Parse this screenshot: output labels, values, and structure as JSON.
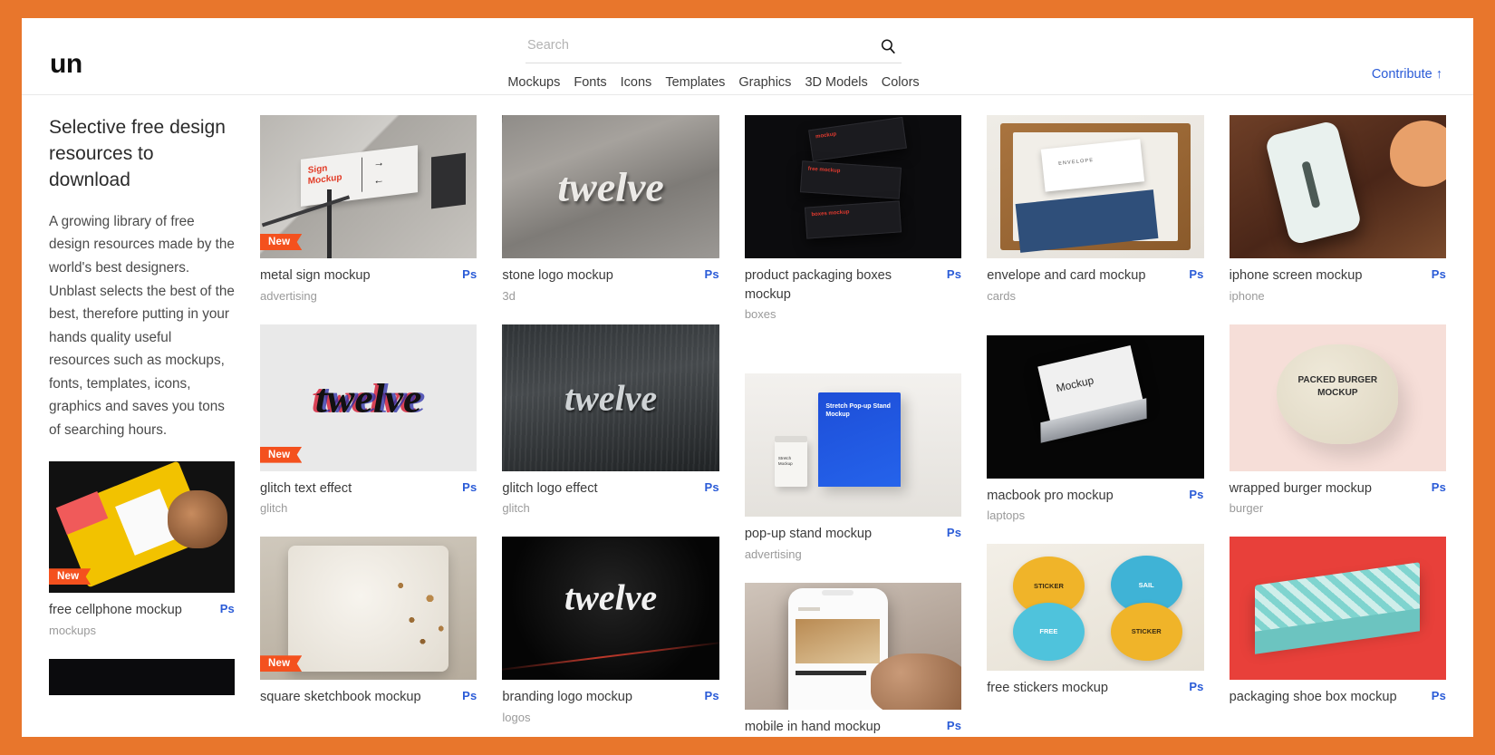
{
  "header": {
    "logo": "un",
    "search": {
      "value": "",
      "placeholder": "Search",
      "icon": "search-icon"
    },
    "nav": [
      {
        "label": "Mockups"
      },
      {
        "label": "Fonts"
      },
      {
        "label": "Icons"
      },
      {
        "label": "Templates"
      },
      {
        "label": "Graphics"
      },
      {
        "label": "3D Models"
      },
      {
        "label": "Colors"
      }
    ],
    "contribute": "Contribute ↑"
  },
  "intro": {
    "heading": "Selective free design resources to download",
    "paragraph": "A growing library of free design resources made by the world's best designers. Unblast selects the best of the best, therefore putting in your hands quality useful resources such as mockups, fonts, templates, icons, graphics and saves you tons of searching hours."
  },
  "labels": {
    "badge_new": "New",
    "badge_ps": "Ps"
  },
  "colors": {
    "frame_orange": "#E8762C",
    "badge_new_bg": "#F4511E",
    "link_blue": "#2a5bd7",
    "ps_blue": "#2a5bd7"
  },
  "columns": [
    {
      "cards": [
        {
          "title": "free cellphone mockup",
          "category": "mockups",
          "new": true,
          "ps": "Ps",
          "art": "art-cellphone"
        },
        {
          "title": "",
          "category": "",
          "new": false,
          "ps": "",
          "art": "art-peek"
        }
      ]
    },
    {
      "cards": [
        {
          "title": "metal sign mockup",
          "category": "advertising",
          "new": true,
          "ps": "Ps",
          "art": "art-metalsign"
        },
        {
          "title": "glitch text effect",
          "category": "glitch",
          "new": true,
          "ps": "Ps",
          "art": "art-glitchtext"
        },
        {
          "title": "square sketchbook mockup",
          "category": "",
          "new": true,
          "ps": "Ps",
          "art": "art-sketch"
        }
      ]
    },
    {
      "cards": [
        {
          "title": "stone logo mockup",
          "category": "3d",
          "new": false,
          "ps": "Ps",
          "art": "art-stone"
        },
        {
          "title": "glitch logo effect",
          "category": "glitch",
          "new": false,
          "ps": "Ps",
          "art": "art-glitchlogo"
        },
        {
          "title": "branding logo mockup",
          "category": "logos",
          "new": false,
          "ps": "Ps",
          "art": "art-branding"
        }
      ]
    },
    {
      "cards": [
        {
          "title": "product packaging boxes mockup",
          "category": "boxes",
          "new": false,
          "ps": "Ps",
          "art": "art-boxes"
        },
        {
          "title": "pop-up stand mockup",
          "category": "advertising",
          "new": false,
          "ps": "Ps",
          "art": "art-popup"
        },
        {
          "title": "mobile in hand mockup",
          "category": "",
          "new": false,
          "ps": "Ps",
          "art": "art-mobilehand"
        }
      ]
    },
    {
      "cards": [
        {
          "title": "envelope and card mockup",
          "category": "cards",
          "new": false,
          "ps": "Ps",
          "art": "art-envelope"
        },
        {
          "title": "macbook pro mockup",
          "category": "laptops",
          "new": false,
          "ps": "Ps",
          "art": "art-macbook"
        },
        {
          "title": "free stickers mockup",
          "category": "",
          "new": false,
          "ps": "Ps",
          "art": "art-stickers"
        }
      ]
    },
    {
      "cards": [
        {
          "title": "iphone screen mockup",
          "category": "iphone",
          "new": false,
          "ps": "Ps",
          "art": "art-iphone"
        },
        {
          "title": "wrapped burger mockup",
          "category": "burger",
          "new": false,
          "ps": "Ps",
          "art": "art-burger"
        },
        {
          "title": "packaging shoe box mockup",
          "category": "",
          "new": false,
          "ps": "Ps",
          "art": "art-shoebox"
        }
      ]
    }
  ],
  "thumb_text": {
    "metalsign": {
      "line1": "Sign",
      "line2": "Mockup"
    },
    "stone_word": "twelve",
    "glitchtext_word": "twelve",
    "glitchlogo_word": "twelve",
    "branding_word": "twelve",
    "macbook_word": "Mockup",
    "burger": "PACKED BURGER MOCKUP",
    "popup": "Stretch Pop-up Stand Mockup",
    "envelope": "ENVELOPE",
    "stickers": [
      "STICKER",
      "SAIL",
      "FREE",
      "STICKER"
    ]
  }
}
